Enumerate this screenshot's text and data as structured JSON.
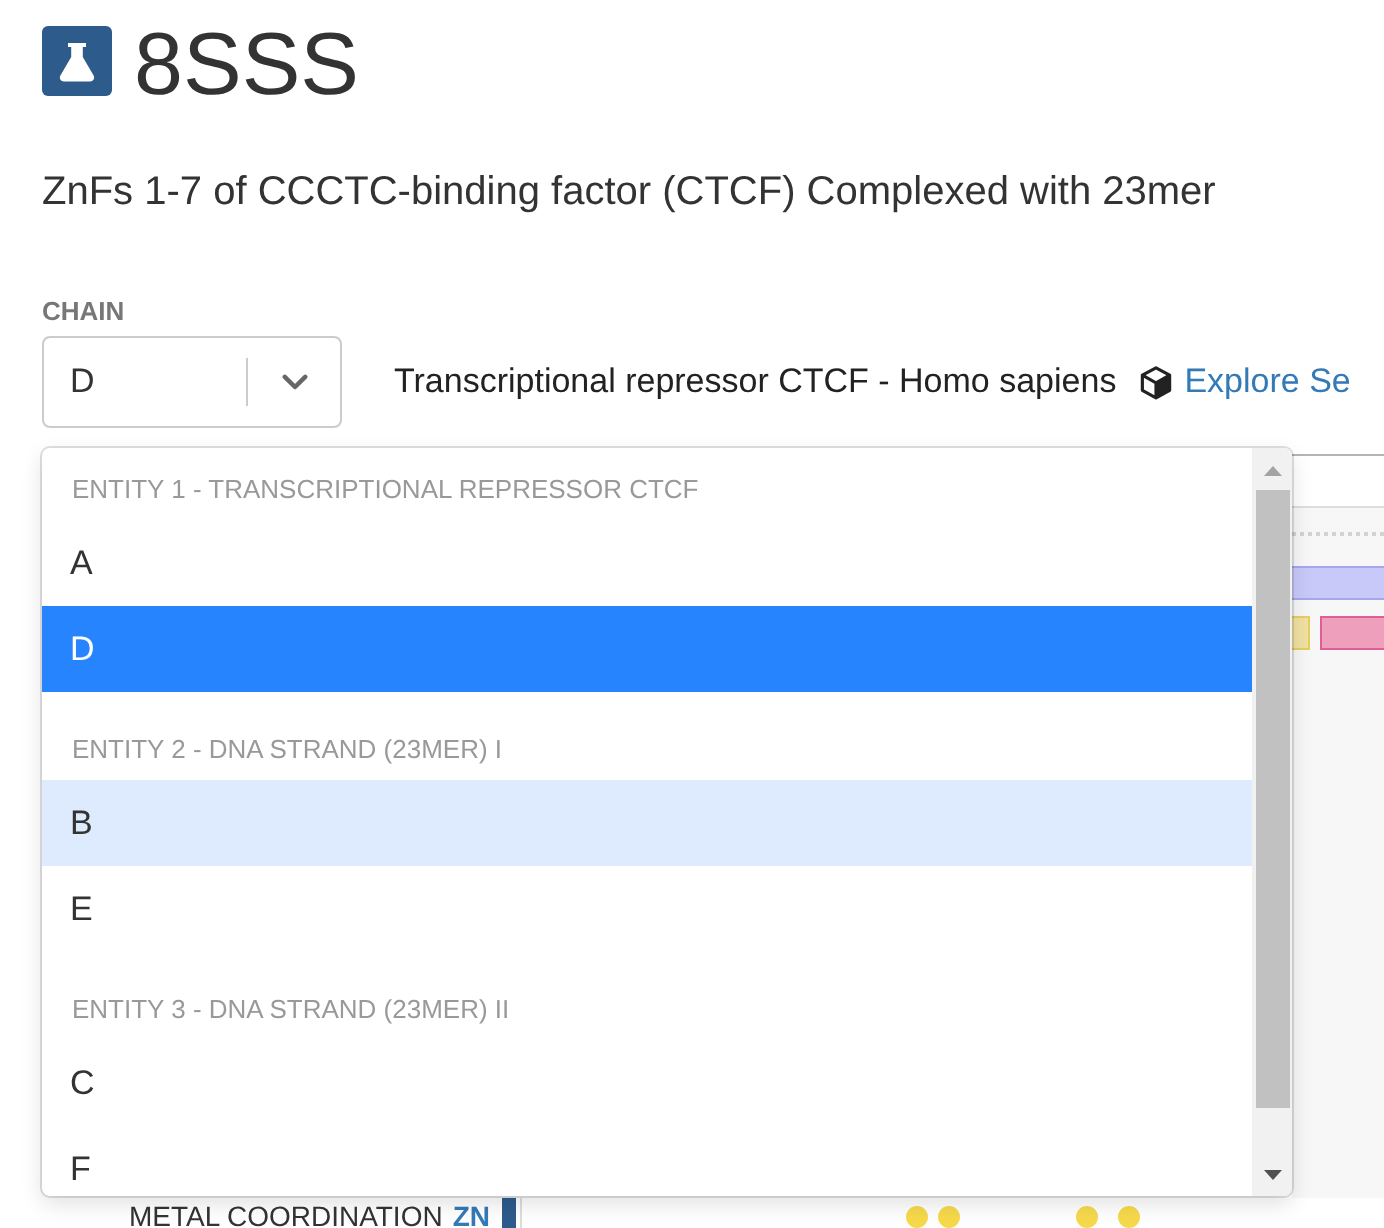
{
  "header": {
    "title": "8SSS",
    "subtitle": "ZnFs 1-7 of CCCTC-binding factor (CTCF) Complexed with 23mer"
  },
  "chain_select": {
    "label": "CHAIN",
    "value": "D",
    "expanded": true
  },
  "entity": {
    "description": "Transcriptional repressor CTCF - Homo sapiens",
    "link": "Explore Se"
  },
  "chain_menu": {
    "groups": [
      {
        "heading": "ENTITY 1 - TRANSCRIPTIONAL REPRESSOR CTCF",
        "options": [
          {
            "label": "A",
            "selected": false,
            "focused": false
          },
          {
            "label": "D",
            "selected": true,
            "focused": false
          }
        ]
      },
      {
        "heading": "ENTITY 2 - DNA STRAND (23MER) I",
        "options": [
          {
            "label": "B",
            "selected": false,
            "focused": true
          },
          {
            "label": "E",
            "selected": false,
            "focused": false
          }
        ]
      },
      {
        "heading": "ENTITY 3 - DNA STRAND (23MER) II",
        "options": [
          {
            "label": "C",
            "selected": false,
            "focused": false
          },
          {
            "label": "F",
            "selected": false,
            "focused": false
          }
        ]
      }
    ]
  },
  "annotation": {
    "label": "METAL COORDINATION",
    "ligand": "ZN"
  }
}
